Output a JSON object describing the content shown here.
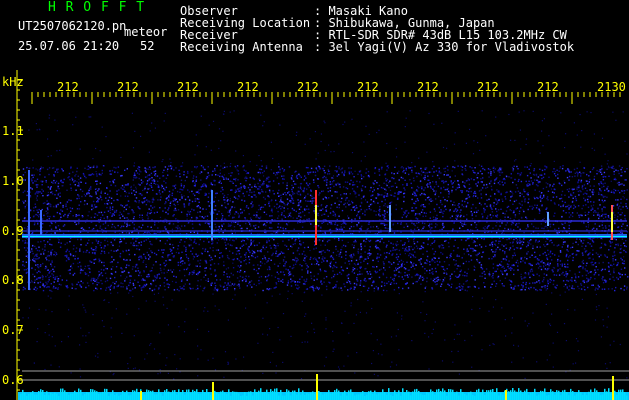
{
  "header": {
    "app_title": "H R O F F T",
    "file_name": "UT2507062120.pn",
    "mode_label": "meteor",
    "datetime": "25.07.06 21:20",
    "count": "52",
    "fields": [
      {
        "label": "Observer",
        "value": ": Masaki Kano"
      },
      {
        "label": "Receiving Location",
        "value": ": Shibukawa, Gunma, Japan"
      },
      {
        "label": "Receiver",
        "value": ": RTL-SDR SDR# 43dB L15 103.2MHz CW"
      },
      {
        "label": "Receiving Antenna",
        "value": ": 3el Yagi(V) Az 330 for Vladivostok"
      }
    ]
  },
  "axis": {
    "unit": "kHz",
    "freq_ticks": [
      "1.1",
      "1.0",
      "0.9",
      "0.8",
      "0.7",
      "0.6"
    ],
    "time_ticks": [
      "212",
      "212",
      "212",
      "212",
      "212",
      "212",
      "212",
      "212",
      "212",
      "2130"
    ]
  },
  "colors": {
    "axis_yellow": "#ffff00",
    "title_green": "#00ff00",
    "text_white": "#ffffff",
    "background": "#000000",
    "trace_cyan": "#00ffff"
  }
}
